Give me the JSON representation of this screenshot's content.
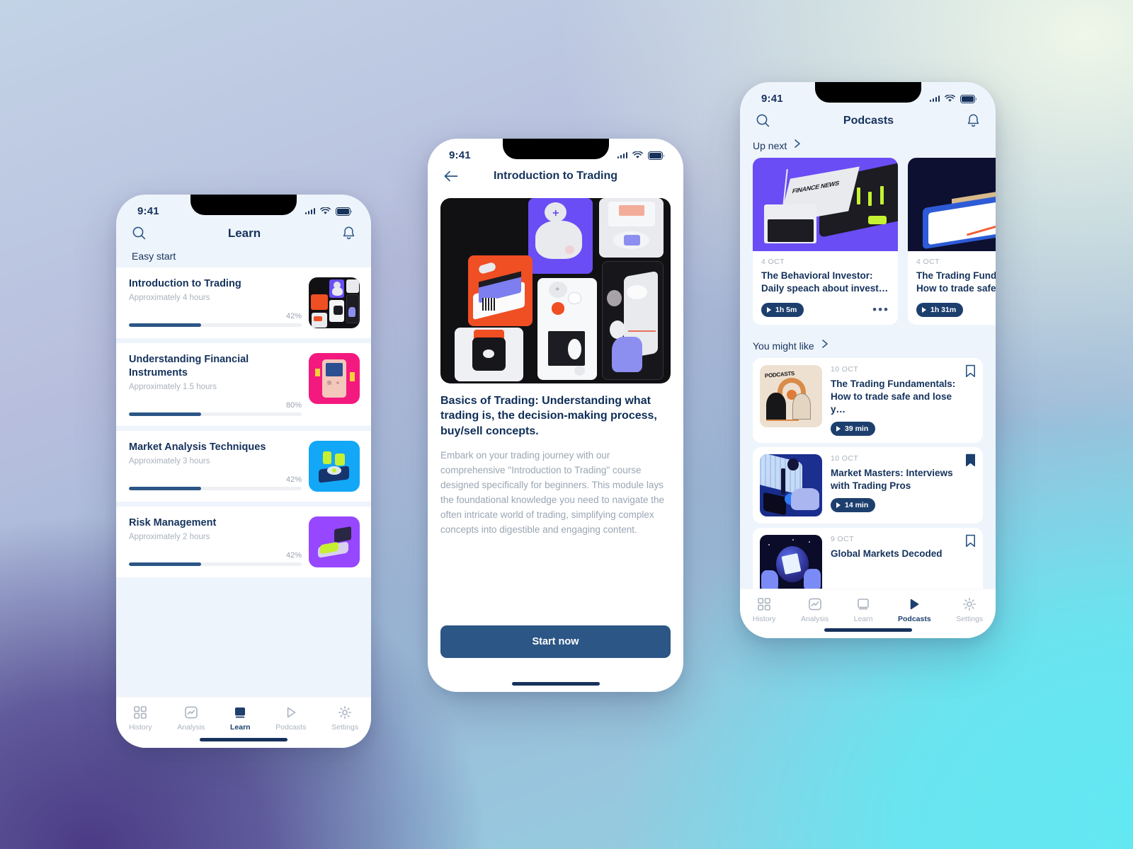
{
  "statusbar": {
    "time": "9:41"
  },
  "learn_screen": {
    "header": {
      "title": "Learn",
      "search_icon": "search-icon",
      "bell_icon": "bell-icon"
    },
    "section_label": "Easy start",
    "courses": [
      {
        "title": "Introduction to Trading",
        "duration": "Approximately 4 hours",
        "progress_label": "42%",
        "progress": 42,
        "thumb": "collage"
      },
      {
        "title": "Understanding Financial Instruments",
        "duration": "Approximately 1.5 hours",
        "progress_label": "80%",
        "progress": 42,
        "thumb": "gameboy"
      },
      {
        "title": "Market Analysis Techniques",
        "duration": "Approximately 3 hours",
        "progress_label": "42%",
        "progress": 42,
        "thumb": "dj"
      },
      {
        "title": "Risk Management",
        "duration": "Approximately 2 hours",
        "progress_label": "42%",
        "progress": 42,
        "thumb": "risk"
      }
    ],
    "tabs": [
      {
        "label": "History",
        "icon": "grid-icon",
        "active": false
      },
      {
        "label": "Analysis",
        "icon": "chart-icon",
        "active": false
      },
      {
        "label": "Learn",
        "icon": "book-icon",
        "active": true
      },
      {
        "label": "Podcasts",
        "icon": "play-icon",
        "active": false
      },
      {
        "label": "Settings",
        "icon": "gear-icon",
        "active": false
      }
    ]
  },
  "course_screen": {
    "header": {
      "title": "Introduction to Trading",
      "back_icon": "back-arrow-icon"
    },
    "heading": "Basics of Trading: Understanding what trading is, the decision-making process, buy/sell concepts.",
    "paragraph": "Embark on your trading journey with our comprehensive \"Introduction to Trading\" course designed specifically for beginners. This module lays the foundational knowledge you need to navigate the often intricate world of trading, simplifying complex concepts into digestible and engaging content.",
    "cta_label": "Start now"
  },
  "podcast_screen": {
    "header": {
      "title": "Podcasts",
      "search_icon": "search-icon",
      "bell_icon": "bell-icon"
    },
    "up_next": {
      "label": "Up next",
      "chevron": "chevron-right-icon",
      "items": [
        {
          "date": "4 OCT",
          "title": "The Behavioral Investor: Daily speach about invest…",
          "duration": "1h 5m",
          "cover": "finance-news",
          "more_icon": "more-horizontal-icon"
        },
        {
          "date": "4 OCT",
          "title": "The Trading Fundamentals: How to trade safe a",
          "duration": "1h 31m",
          "cover": "desk-notebook"
        }
      ]
    },
    "you_might_like": {
      "label": "You might like",
      "chevron": "chevron-right-icon",
      "items": [
        {
          "date": "10 OCT",
          "title": "The Trading Fundamentals: How to trade safe and lose y…",
          "duration": "39 min",
          "cover": "retro-podcast-poster",
          "bookmarked": false
        },
        {
          "date": "10 OCT",
          "title": "Market Masters: Interviews with Trading Pros",
          "duration": "14 min",
          "cover": "microphone-desk",
          "bookmarked": true
        },
        {
          "date": "9 OCT",
          "title": "Global Markets Decoded",
          "duration": "",
          "cover": "globe-hands",
          "bookmarked": false
        }
      ]
    },
    "tabs": [
      {
        "label": "History",
        "icon": "grid-icon",
        "active": false
      },
      {
        "label": "Analysis",
        "icon": "chart-icon",
        "active": false
      },
      {
        "label": "Learn",
        "icon": "book-icon",
        "active": false
      },
      {
        "label": "Podcasts",
        "icon": "play-icon",
        "active": true
      },
      {
        "label": "Settings",
        "icon": "gear-icon",
        "active": false
      }
    ]
  },
  "colors": {
    "primary": "#2b5685",
    "title": "#16325c",
    "muted": "#aab2bd",
    "surface": "#ffffff",
    "screen_bg": "#eef4fb"
  }
}
